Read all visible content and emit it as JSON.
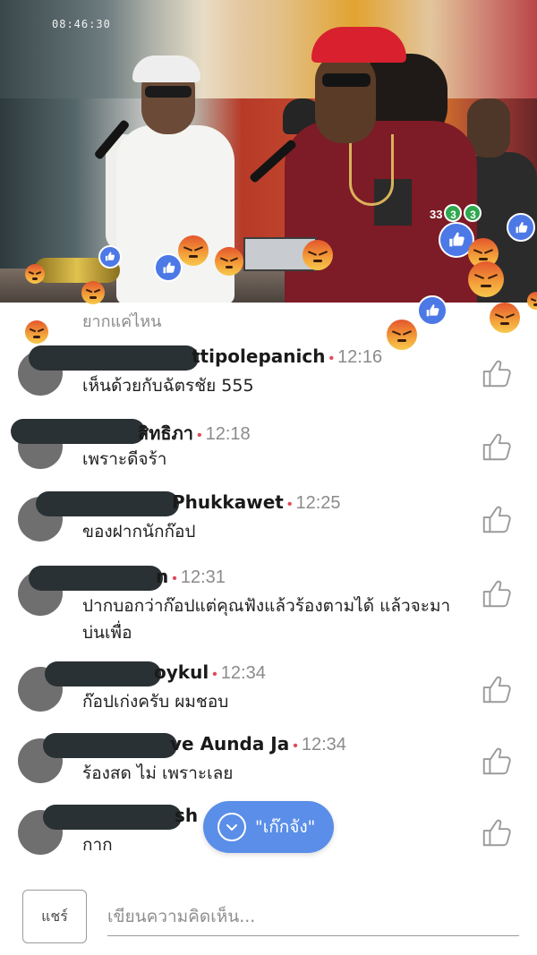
{
  "video": {
    "timestamp": "08:46:30"
  },
  "comments_panel": {
    "previous_text": "ยากแค่ไหน",
    "comments": [
      {
        "name": "ttipolepanich",
        "time": "12:16",
        "text": "เห็นด้วยกับฉัตรชัย 555"
      },
      {
        "name": "สิทธิภา",
        "time": "12:18",
        "text": "เพราะดีจร้า"
      },
      {
        "name": "Phukkawet",
        "time": "12:25",
        "text": "ของฝากนักก๊อป"
      },
      {
        "name": "n",
        "time": "12:31",
        "text": "ปากบอกว่าก๊อปแต่คุณฟังแล้วร้องตามได้ แล้วจะมาบ่นเพื่อ"
      },
      {
        "name": "oykul",
        "time": "12:34",
        "text": "ก๊อปเก่งครับ ผมชอบ"
      },
      {
        "name": "ve Aunda Ja",
        "time": "12:34",
        "text": "ร้องสด ไม่ เพราะเลย"
      },
      {
        "name": "sh",
        "time": "",
        "text": "กาก"
      }
    ]
  },
  "reaction_pill": {
    "label": "\"เก๊กจัง\""
  },
  "composer": {
    "share_label": "แชร์",
    "input_placeholder": "เขียนความคิดเห็น..."
  },
  "colors": {
    "like_blue": "#4c79e6",
    "pill_blue": "#5a8ee8",
    "time_dot": "#e04a58",
    "muted_text": "#8b8b8b"
  },
  "icons": [
    "like-reaction-icon",
    "angry-reaction-icon",
    "thumbs-up-icon",
    "chevron-down-icon"
  ]
}
